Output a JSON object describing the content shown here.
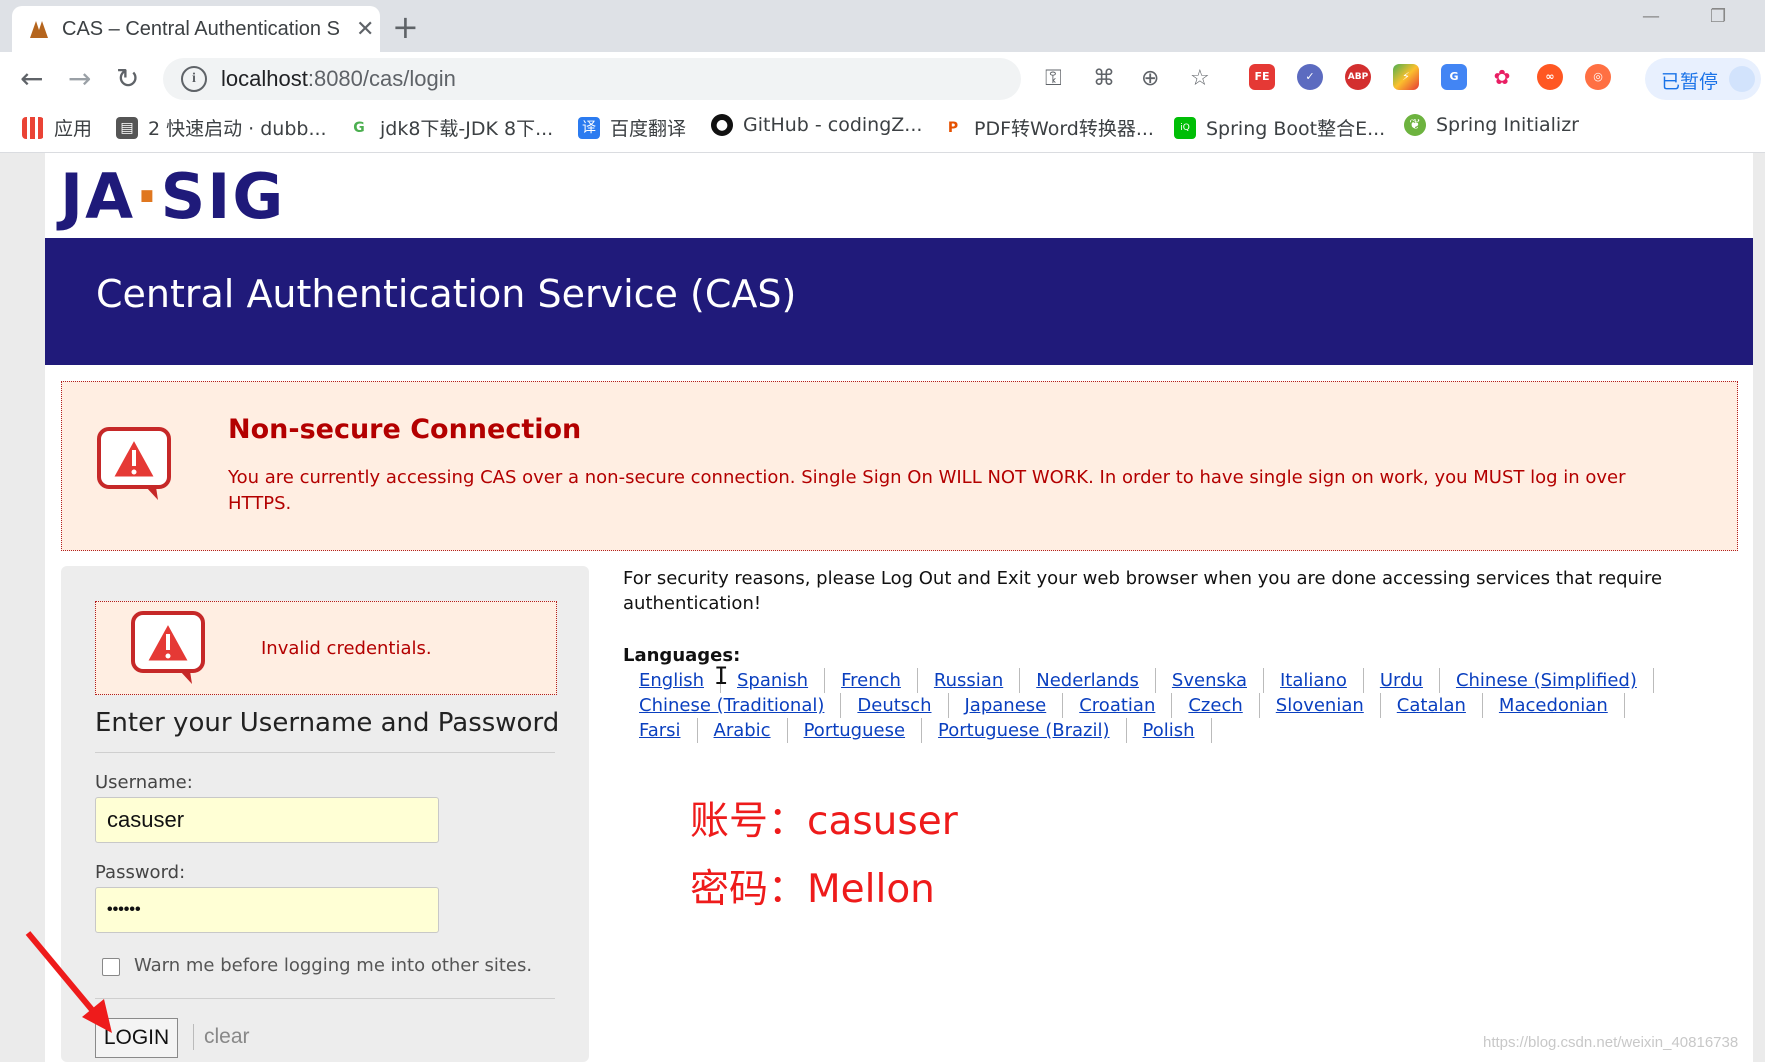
{
  "browser": {
    "tab_title": "CAS – Central Authentication S",
    "tab_close": "✕",
    "new_tab": "+",
    "url_host": "localhost",
    "url_rest": ":8080/cas/login",
    "profile_label": "已暂停",
    "bookmarks": [
      {
        "label": "应用",
        "icon": "apps-grid-icon"
      },
      {
        "label": "2 快速启动 · dubb...",
        "icon": "book-icon"
      },
      {
        "label": "jdk8下载-JDK 8下...",
        "icon": "g-icon"
      },
      {
        "label": "百度翻译",
        "icon": "translate-icon"
      },
      {
        "label": "GitHub - codingZ...",
        "icon": "github-icon"
      },
      {
        "label": "PDF转Word转换器...",
        "icon": "pdf-icon"
      },
      {
        "label": "Spring Boot整合E...",
        "icon": "iqiyi-icon"
      },
      {
        "label": "Spring Initializr",
        "icon": "spring-icon"
      }
    ]
  },
  "page": {
    "logo": "JA-SIG",
    "banner_title": "Central Authentication Service (CAS)",
    "warning": {
      "title": "Non-secure Connection",
      "body": "You are currently accessing CAS over a non-secure connection. Single Sign On WILL NOT WORK. In order to have single sign on work, you MUST log in over HTTPS."
    },
    "login": {
      "error": "Invalid credentials.",
      "heading": "Enter your Username and Password",
      "username_label": "Username:",
      "username_value": "casuser",
      "password_label": "Password:",
      "password_value": "••••••",
      "warn_label": "Warn me before logging me into other sites.",
      "login_button": "LOGIN",
      "clear_link": "clear"
    },
    "security_note": "For security reasons, please Log Out and Exit your web browser when you are done accessing services that require authentication!",
    "languages_title": "Languages:",
    "languages": [
      "English",
      "Spanish",
      "French",
      "Russian",
      "Nederlands",
      "Svenska",
      "Italiano",
      "Urdu",
      "Chinese (Simplified)",
      "Chinese (Traditional)",
      "Deutsch",
      "Japanese",
      "Croatian",
      "Czech",
      "Slovenian",
      "Catalan",
      "Macedonian",
      "Farsi",
      "Arabic",
      "Portuguese",
      "Portuguese (Brazil)",
      "Polish"
    ],
    "annotation_account": "账号：casuser",
    "annotation_password": "密码：Mellon",
    "watermark": "https://blog.csdn.net/weixin_40816738"
  },
  "colors": {
    "banner": "#201a7a",
    "warning_text": "#b30000",
    "warning_bg": "#ffeee2",
    "link": "#0a3fbf",
    "annotation": "#ee1b1b"
  }
}
